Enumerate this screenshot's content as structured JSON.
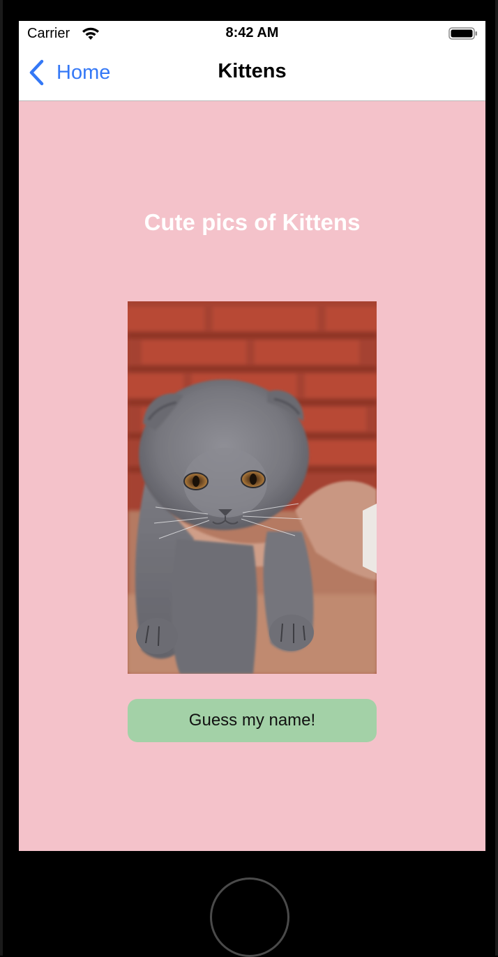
{
  "status_bar": {
    "carrier": "Carrier",
    "time": "8:42 AM",
    "wifi_icon": "wifi-icon",
    "battery_icon": "battery-icon"
  },
  "nav": {
    "back_label": "Home",
    "back_icon": "chevron-left-icon",
    "title": "Kittens"
  },
  "content": {
    "headline": "Cute pics of Kittens",
    "image_subject": "kitten-photo",
    "button_label": "Guess my name!"
  },
  "colors": {
    "background": "#f4c2ca",
    "accent": "#3478f6",
    "button": "#a3d1a7",
    "headline": "#ffffff"
  }
}
